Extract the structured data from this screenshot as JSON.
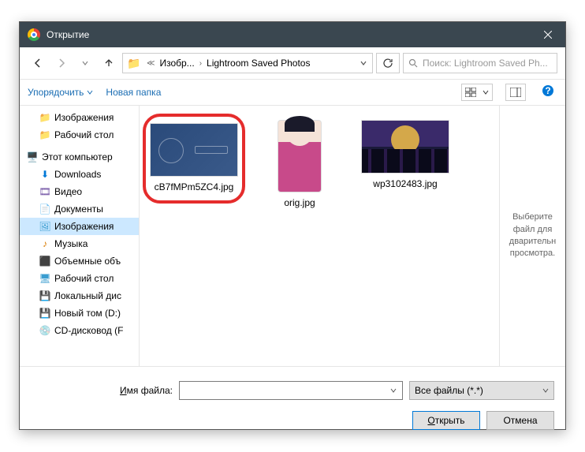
{
  "titlebar": {
    "title": "Открытие"
  },
  "nav": {
    "crumbs": [
      "Изобр...",
      "Lightroom Saved Photos"
    ],
    "search_placeholder": "Поиск: Lightroom Saved Ph..."
  },
  "toolbar": {
    "organize": "Упорядочить",
    "new_folder": "Новая папка"
  },
  "tree": [
    {
      "icon": "folder",
      "label": "Изображения",
      "indent": true
    },
    {
      "icon": "folder",
      "label": "Рабочий стол",
      "indent": true
    },
    {
      "icon": "pc",
      "label": "Этот компьютер",
      "indent": false
    },
    {
      "icon": "dl",
      "label": "Downloads",
      "indent": true
    },
    {
      "icon": "vid",
      "label": "Видео",
      "indent": true
    },
    {
      "icon": "doc",
      "label": "Документы",
      "indent": true
    },
    {
      "icon": "img",
      "label": "Изображения",
      "indent": true,
      "selected": true
    },
    {
      "icon": "mus",
      "label": "Музыка",
      "indent": true
    },
    {
      "icon": "3d",
      "label": "Объемные объ",
      "indent": true
    },
    {
      "icon": "desk",
      "label": "Рабочий стол",
      "indent": true
    },
    {
      "icon": "disk",
      "label": "Локальный дис",
      "indent": true
    },
    {
      "icon": "disk",
      "label": "Новый том (D:)",
      "indent": true
    },
    {
      "icon": "cd",
      "label": "CD-дисковод (F",
      "indent": true
    }
  ],
  "files": [
    {
      "name": "cB7fMPm5ZC4.jpg",
      "thumb": "blueprint",
      "highlight": true
    },
    {
      "name": "orig.jpg",
      "thumb": "girl"
    },
    {
      "name": "wp3102483.jpg",
      "thumb": "city"
    }
  ],
  "preview": {
    "text": "Выберите файл для дварительн просмотра."
  },
  "footer": {
    "filename_label_prefix": "И",
    "filename_label_rest": "мя файла:",
    "filename_value": "",
    "filter": "Все файлы (*.*)",
    "open_btn_underline": "О",
    "open_btn_rest": "ткрыть",
    "cancel_btn": "Отмена"
  }
}
